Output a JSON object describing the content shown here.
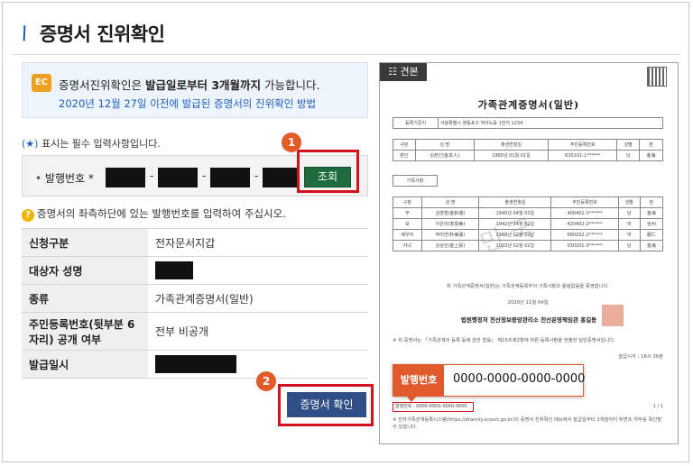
{
  "page": {
    "title": "증명서 진위확인"
  },
  "notice": {
    "icon": "notice-icon",
    "prefix": "증명서진위확인은 ",
    "bold": "발급일로부터 3개월까지",
    "suffix": " 가능합니다.",
    "link": "2020년 12월 27일 이전에 발급된 증명서의 진위확인 방법"
  },
  "required": {
    "star": "(★)",
    "text": " 표시는 필수 입력사항입니다."
  },
  "issue_number": {
    "label": "발행번호",
    "star": "*",
    "query_button": "조회",
    "separator": "-"
  },
  "step_badges": {
    "one": "1",
    "two": "2"
  },
  "hint": {
    "icon": "?",
    "text": "증명서의 좌측하단에 있는 발행번호를 입력하여 주십시오."
  },
  "info_rows": [
    {
      "key": "신청구분",
      "value": "전자문서지갑"
    },
    {
      "key": "대상자 성명",
      "value": ""
    },
    {
      "key": "종류",
      "value": "가족관계증명서(일반)"
    },
    {
      "key": "주민등록번호(뒷부분 6자리) 공개 여부",
      "value": "전부 비공개"
    },
    {
      "key": "발급일시",
      "value": ""
    }
  ],
  "confirm_button": "증명서 확인",
  "sample": {
    "tag": "견본",
    "doc_title": "가족관계증명서(일반)",
    "reg_label": "등록기준지",
    "reg_value": "서울특별시 영등포구 여의도동 1번지 1234",
    "headers": [
      "구분",
      "성 명",
      "출생연월일",
      "주민등록번호",
      "성별",
      "본"
    ],
    "self_row": [
      "본인",
      "김본인(金本人)",
      "1965년 01월 01일",
      "630101-1******",
      "남",
      "金海"
    ],
    "family_label": "가족사항",
    "family_rows": [
      [
        "부",
        "김영철(金鈴澈)",
        "1940년 04월 01일",
        "400401-1******",
        "남",
        "金海"
      ],
      [
        "모",
        "이은미(李恩美)",
        "1942년 04월 02일",
        "420402-2******",
        "여",
        "全州"
      ],
      [
        "배우자",
        "박미연(朴美蓮)",
        "1968년 02월 02일",
        "680202-2******",
        "여",
        "順仁"
      ],
      [
        "자녀",
        "김상민(金上民)",
        "2003년 02월 01일",
        "030201-3******",
        "남",
        "金海"
      ]
    ],
    "statement": "위 가족관계증명서(일반)는 가족관계등록부의 기록사항과 틀림없음을 증명합니다.",
    "date": "2020년 11월 04일",
    "issuer": "법원행정처 전산정보중앙관리소 전산운영책임관 홍길동",
    "note1": "※ 위 증명서는 「가족관계의 등록 등에 관한 법률」 제15조제2항에 따른 등록사항을 현출한 일반증명서입니다.",
    "note2": "발급시각 : 16시 36분",
    "note3": "발급담당자 : 김민인",
    "callout_label": "발행번호",
    "callout_number": "0000-0000-0000-0000",
    "issue_no_text": "발행번호 : 0000-0000-0000-0000",
    "page_no": "1 / 1",
    "footer": "※ 전자가족관계등록시스템(https://efamily.scourt.go.kr)의 증명서 진위확인 메뉴에서 발급일부터 3개월까지 위변조 여부를 확인할 수 있습니다.",
    "watermark": "민 국"
  }
}
